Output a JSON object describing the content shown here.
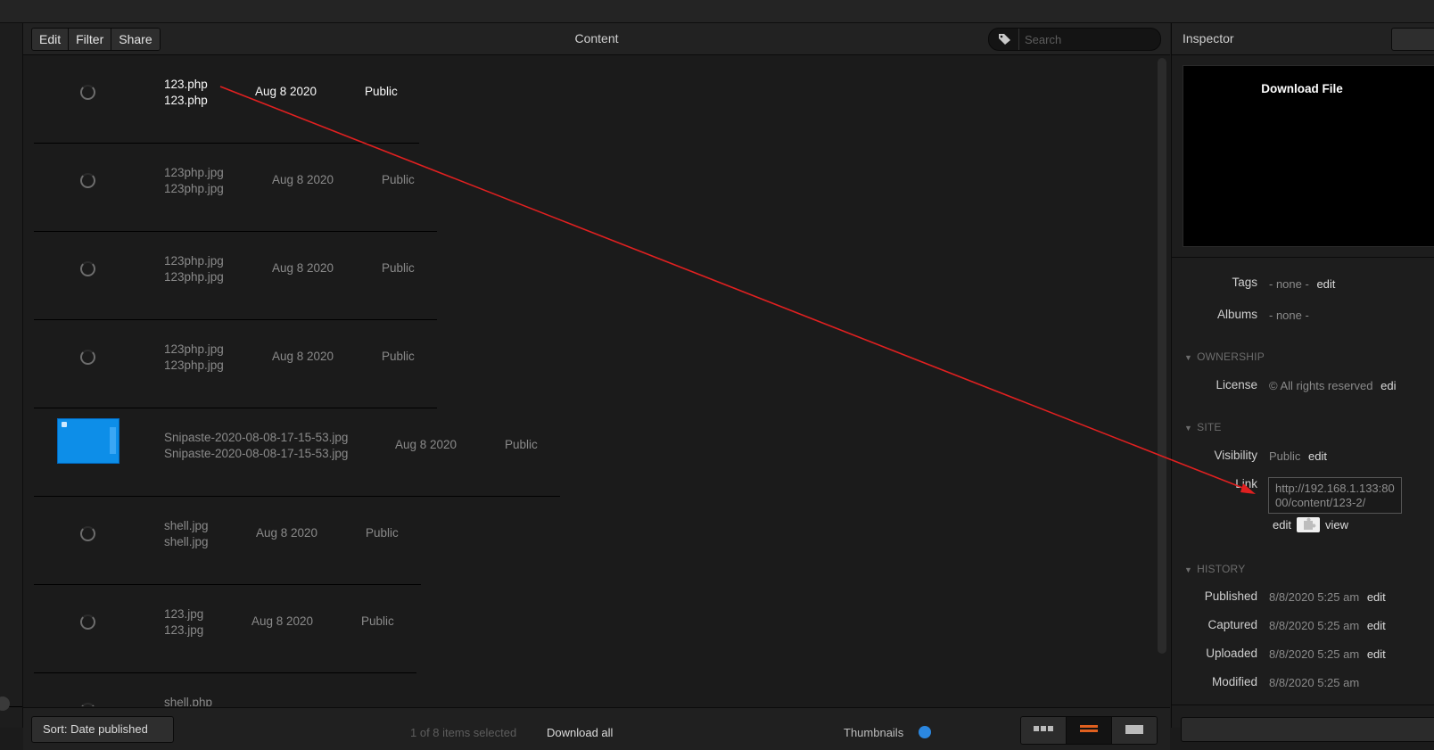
{
  "toolbar": {
    "buttons": [
      "Edit",
      "Filter",
      "Share"
    ],
    "title": "Content",
    "search_placeholder": "Search"
  },
  "content": {
    "rows": [
      {
        "name1": "123.php",
        "name2": "123.php",
        "date": "Aug 8 2020",
        "visibility": "Public",
        "thumb": "spinner",
        "selected": true
      },
      {
        "name1": "123php.jpg",
        "name2": "123php.jpg",
        "date": "Aug 8 2020",
        "visibility": "Public",
        "thumb": "spinner"
      },
      {
        "name1": "123php.jpg",
        "name2": "123php.jpg",
        "date": "Aug 8 2020",
        "visibility": "Public",
        "thumb": "spinner"
      },
      {
        "name1": "123php.jpg",
        "name2": "123php.jpg",
        "date": "Aug 8 2020",
        "visibility": "Public",
        "thumb": "spinner"
      },
      {
        "name1": "Snipaste-2020-08-08-17-15-53.jpg",
        "name2": "Snipaste-2020-08-08-17-15-53.jpg",
        "date": "Aug 8 2020",
        "visibility": "Public",
        "thumb": "image"
      },
      {
        "name1": "shell.jpg",
        "name2": "shell.jpg",
        "date": "Aug 8 2020",
        "visibility": "Public",
        "thumb": "spinner"
      },
      {
        "name1": "123.jpg",
        "name2": "123.jpg",
        "date": "Aug 8 2020",
        "visibility": "Public",
        "thumb": "spinner"
      },
      {
        "name1": "shell.php",
        "name2": "",
        "date": "",
        "visibility": "",
        "thumb": "spinner"
      }
    ]
  },
  "bottom": {
    "sort_label": "Sort: Date published",
    "count_text": "1 of 8 items selected",
    "download_all": "Download all",
    "thumb_label": "Thumbnails"
  },
  "inspector": {
    "title": "Inspector",
    "preview_label": "Download File",
    "tags_label": "Tags",
    "tags_value": "- none -",
    "albums_label": "Albums",
    "albums_value": "- none -",
    "edit_label": "edit",
    "view_label": "view",
    "sections": {
      "ownership": "OWNERSHIP",
      "site": "SITE",
      "history": "HISTORY"
    },
    "license_label": "License",
    "license_value": "© All rights reserved",
    "license_edit": "edi",
    "visibility_label": "Visibility",
    "visibility_value": "Public",
    "link_label": "Link",
    "link_value": "http://192.168.1.133:8000/content/123-2/",
    "history": [
      {
        "label": "Published",
        "value": "8/8/2020 5:25 am",
        "edit": "edit"
      },
      {
        "label": "Captured",
        "value": "8/8/2020 5:25 am",
        "edit": "edit"
      },
      {
        "label": "Uploaded",
        "value": "8/8/2020 5:25 am",
        "edit": "edit"
      },
      {
        "label": "Modified",
        "value": "8/8/2020 5:25 am",
        "edit": ""
      }
    ]
  },
  "colors": {
    "background": "#1b1b1b",
    "annotation_arrow": "#e02020",
    "accent": "#2b87e0",
    "active_view_icon": "#e0601f"
  }
}
